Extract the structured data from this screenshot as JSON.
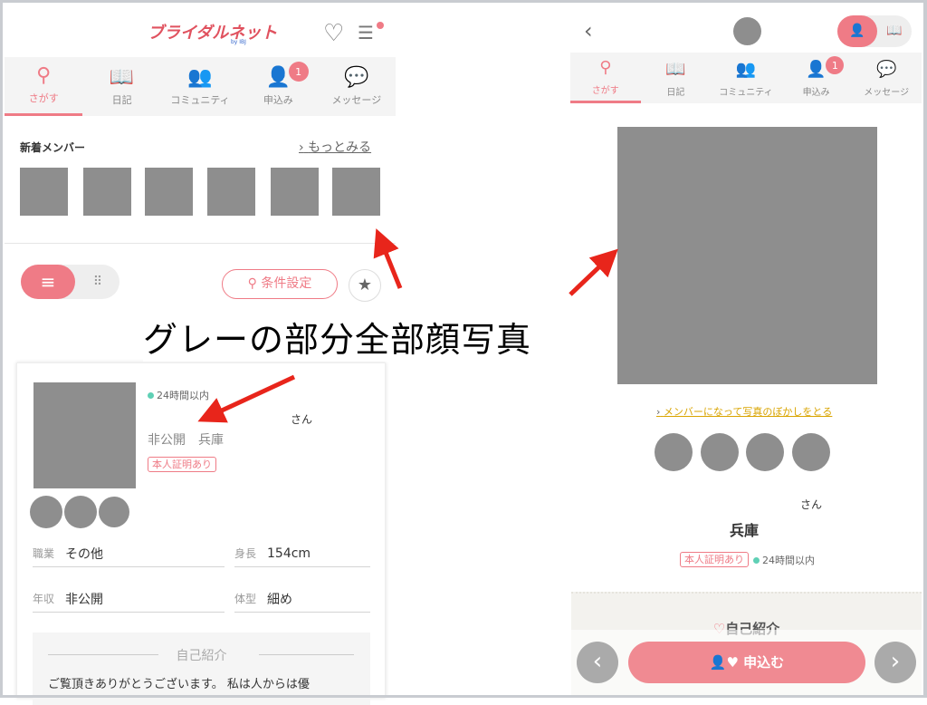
{
  "left": {
    "logo": "ブライダルネット",
    "logo_sub": "by IBJ",
    "tabs": [
      {
        "label": "さがす",
        "icon": "search-icon"
      },
      {
        "label": "日記",
        "icon": "book-icon"
      },
      {
        "label": "コミュニティ",
        "icon": "people-icon"
      },
      {
        "label": "申込み",
        "icon": "person-heart-icon",
        "badge": "1"
      },
      {
        "label": "メッセージ",
        "icon": "chat-icon"
      }
    ],
    "new_members": "新着メンバー",
    "more": "もっとみる",
    "filter": "条件設定",
    "card": {
      "online": "24時間以内",
      "san": "さん",
      "age_area": "非公開　兵庫",
      "cert": "本人証明あり",
      "fields": [
        {
          "k": "職業",
          "v": "その他"
        },
        {
          "k": "身長",
          "v": "154cm"
        },
        {
          "k": "年収",
          "v": "非公開"
        },
        {
          "k": "体型",
          "v": "細め"
        }
      ],
      "intro_title": "自己紹介",
      "intro_text": "ご覧頂きありがとうございます。 私は人からは優"
    }
  },
  "annotation": "グレーの部分全部顔写真",
  "right": {
    "tabs": [
      {
        "label": "さがす"
      },
      {
        "label": "日記"
      },
      {
        "label": "コミュニティ"
      },
      {
        "label": "申込み",
        "badge": "1"
      },
      {
        "label": "メッセージ"
      }
    ],
    "blur_link": "メンバーになって写真のぼかしをとる",
    "san": "さん",
    "area": "兵庫",
    "cert": "本人証明あり",
    "online": "24時間以内",
    "intro_title": "自己紹介",
    "apply": "申込む"
  },
  "colors": {
    "accent": "#ef7b86",
    "placeholder": "#8e8e8e",
    "arrow": "#e8251b"
  }
}
